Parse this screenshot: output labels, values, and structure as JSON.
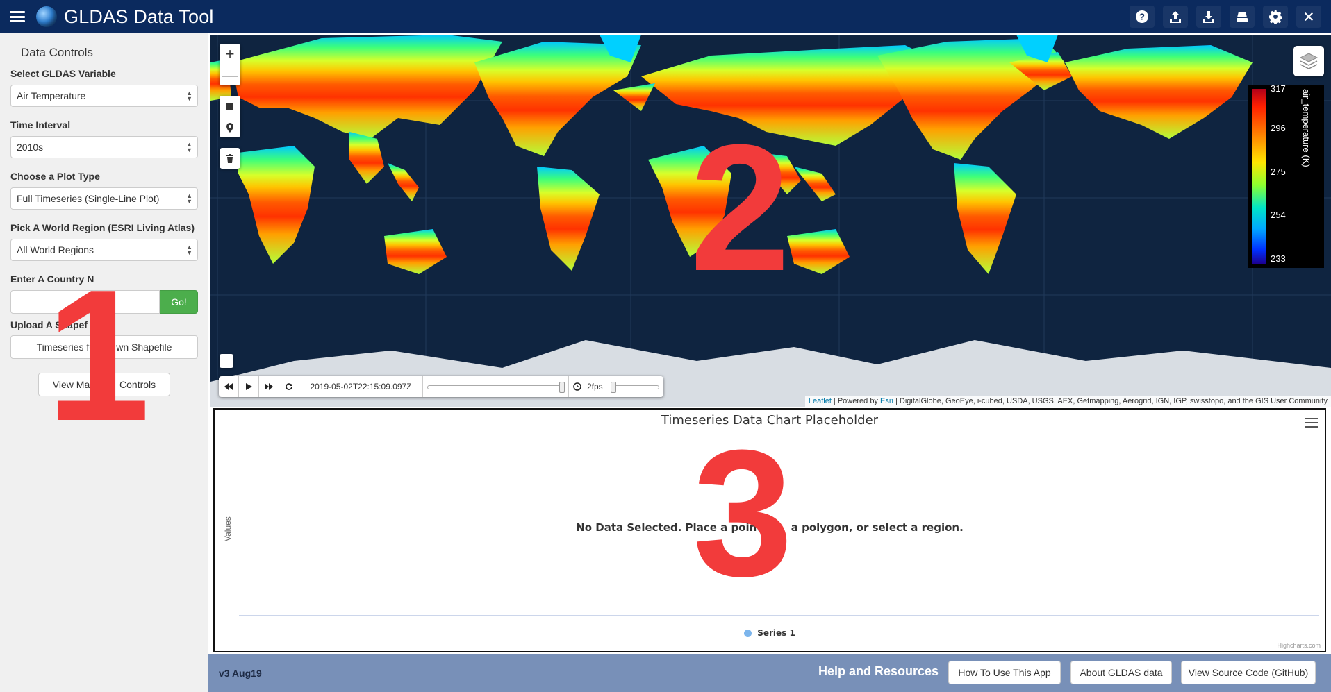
{
  "header": {
    "title": "GLDAS Data Tool",
    "actions": [
      "help-icon",
      "upload-icon",
      "download-icon",
      "print-icon",
      "settings-icon",
      "close-icon"
    ]
  },
  "sidebar": {
    "title": "Data Controls",
    "variable": {
      "label": "Select GLDAS Variable",
      "value": "Air Temperature"
    },
    "interval": {
      "label": "Time Interval",
      "value": "2010s"
    },
    "plot_type": {
      "label": "Choose a Plot Type",
      "value": "Full Timeseries (Single-Line Plot)"
    },
    "region": {
      "label": "Pick A World Region (ESRI Living Atlas)",
      "value": "All World Regions"
    },
    "country": {
      "label": "Enter A Country N",
      "value": "",
      "go_label": "Go!"
    },
    "shapefile": {
      "label": "Upload A Shapef",
      "button_label": "Timeseries fo        wn Shapefile"
    },
    "view_button": "View Map         Controls"
  },
  "annotations": {
    "one": "1",
    "two": "2",
    "three": "3"
  },
  "map": {
    "zoom_in": "+",
    "zoom_out": "—",
    "legend": {
      "title": "air_temperature (K)",
      "ticks": [
        "317",
        "296",
        "275",
        "254",
        "233"
      ]
    },
    "time": {
      "current": "2019-05-02T22:15:09.097Z",
      "fps": "2fps",
      "progress": 1.0
    },
    "attribution_link": "Leaflet",
    "attribution_mid": " | Powered by ",
    "attribution_esri": "Esri",
    "attribution_rest": " | DigitalGlobe, GeoEye, i-cubed, USDA, USGS, AEX, Getmapping, Aerogrid, IGN, IGP, swisstopo, and the GIS User Community",
    "colors": {
      "ocean": "#0f2440",
      "land_ice": "#d8dde3"
    }
  },
  "chart": {
    "title": "Timeseries Data Chart Placeholder",
    "ylabel": "Values",
    "no_data": "No Data Selected. Place a point,       a polygon, or select a region.",
    "legend_series": "Series 1",
    "credits": "Highcharts.com"
  },
  "chart_data": {
    "type": "line",
    "title": "Timeseries Data Chart Placeholder",
    "ylabel": "Values",
    "series": [
      {
        "name": "Series 1",
        "values": []
      }
    ]
  },
  "footer": {
    "version": "v3 Aug19",
    "help_title": "Help and Resources",
    "buttons": [
      "How To Use This App",
      "About GLDAS data",
      "View Source Code (GitHub)"
    ]
  }
}
